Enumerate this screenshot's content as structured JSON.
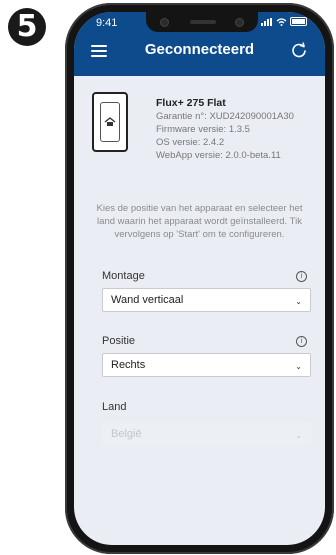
{
  "step_number": "5",
  "status_bar": {
    "time": "9:41"
  },
  "header": {
    "title": "Geconnecteerd"
  },
  "device": {
    "name": "Flux+ 275 Flat",
    "warranty": "Garantie n°: XUD242090001A30",
    "firmware": "Firmware versie: 1.3.5",
    "os": "OS versie: 2.4.2",
    "webapp": "WebApp versie: 2.0.0-beta.11"
  },
  "intro_text": "Kies de positie van het apparaat en selecteer het land waarin het apparaat wordt geïnstalleerd. Tik vervolgens op 'Start' om te configureren.",
  "fields": {
    "montage": {
      "label": "Montage",
      "value": "Wand verticaal"
    },
    "positie": {
      "label": "Positie",
      "value": "Rechts"
    },
    "land": {
      "label": "Land",
      "value": "België"
    }
  },
  "colors": {
    "header": "#0d4b8c",
    "background": "#eaeef4"
  }
}
